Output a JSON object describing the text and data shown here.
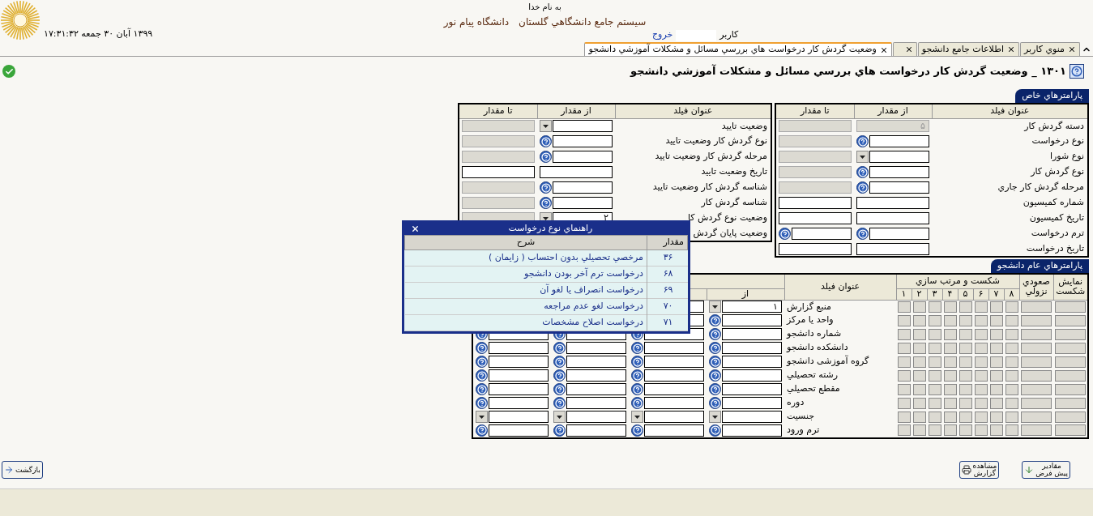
{
  "header": {
    "greeting": "به نام خدا",
    "system_name": "سیستم جامع دانشگاهي گلستان",
    "university": "دانشگاه پیام نور",
    "datetime": "۱۳۹۹ آبان ۳۰ جمعه ۱۷:۳۱:۳۲",
    "user_label": "کاربر",
    "logout": "خروج"
  },
  "tabs": [
    {
      "label": "منوي کاربر",
      "selected": false
    },
    {
      "label": "اطلاعات جامع دانشجو",
      "selected": false
    },
    {
      "selected": false
    },
    {
      "label": "وضعیت گردش کار درخواست هاي بررسي مسائل و مشكلات آموزشي دانشجو",
      "selected": true
    }
  ],
  "page_title": "۱۳۰۱ _ وضعیت  گردش کار درخواست هاي بررسي مسائل و مشكلات آموزشي دانشجو",
  "special_params": {
    "label": "پارامترهاي خاص",
    "tables": [
      {
        "columns": [
          "عنوان فیلد",
          "از مقدار",
          "تا مقدار"
        ],
        "rows": [
          {
            "title": "دسته گردش کار",
            "from": {
              "kind": "text",
              "disabled": true,
              "value": "۵"
            },
            "to": {
              "kind": "text",
              "disabled": true
            }
          },
          {
            "title": "نوع درخواست",
            "from": {
              "kind": "lookup",
              "disabled": false
            },
            "to": {
              "kind": "text",
              "disabled": true
            }
          },
          {
            "title": "نوع شورا",
            "from": {
              "kind": "dropdown",
              "disabled": false
            },
            "to": {
              "kind": "text",
              "disabled": true
            }
          },
          {
            "title": "نوع گردش کار",
            "from": {
              "kind": "lookup",
              "disabled": false
            },
            "to": {
              "kind": "text",
              "disabled": true
            }
          },
          {
            "title": "مرحله گردش کار جاري",
            "from": {
              "kind": "lookup",
              "disabled": false
            },
            "to": {
              "kind": "text",
              "disabled": true
            }
          },
          {
            "title": "شماره کمیسیون",
            "from": {
              "kind": "text",
              "disabled": false
            },
            "to": {
              "kind": "text",
              "disabled": false
            }
          },
          {
            "title": "تاریخ کمیسیون",
            "from": {
              "kind": "text",
              "disabled": false
            },
            "to": {
              "kind": "text",
              "disabled": false
            }
          },
          {
            "title": "ترم درخواست",
            "from": {
              "kind": "lookup",
              "disabled": false
            },
            "to": {
              "kind": "lookup",
              "disabled": false
            }
          },
          {
            "title": "تاریخ درخواست",
            "from": {
              "kind": "text",
              "disabled": false
            },
            "to": {
              "kind": "text",
              "disabled": false
            }
          }
        ]
      },
      {
        "columns": [
          "عنوان فیلد",
          "از مقدار",
          "تا مقدار"
        ],
        "rows": [
          {
            "title": "وضعیت تایید",
            "from": {
              "kind": "dropdown",
              "disabled": false
            },
            "to": {
              "kind": "text",
              "disabled": true
            }
          },
          {
            "title": "نوع گردش کار وضعیت تایید",
            "from": {
              "kind": "lookup",
              "disabled": false
            },
            "to": {
              "kind": "text",
              "disabled": true
            }
          },
          {
            "title": "مرحله گردش کار وضعیت تایید",
            "from": {
              "kind": "lookup",
              "disabled": false
            },
            "to": {
              "kind": "text",
              "disabled": true
            }
          },
          {
            "title": "تاریخ وضعیت تایید",
            "from": {
              "kind": "text",
              "disabled": false
            },
            "to": {
              "kind": "text",
              "disabled": false
            }
          },
          {
            "title": "شناسه گردش کار وضعیت تایید",
            "from": {
              "kind": "lookup",
              "disabled": false
            },
            "to": {
              "kind": "text",
              "disabled": true
            }
          },
          {
            "title": "شناسه گردش کار",
            "from": {
              "kind": "lookup",
              "disabled": false
            },
            "to": {
              "kind": "text",
              "disabled": true
            }
          },
          {
            "title": "وضعیت نوع گردش کا",
            "from": {
              "kind": "dropdown",
              "disabled": false,
              "value": "۲"
            },
            "to": {
              "kind": "text",
              "disabled": true
            }
          },
          {
            "title": "وضعیت پایان گردش"
          }
        ]
      }
    ]
  },
  "general_params": {
    "label": "پارامترهاي عام دانشجو",
    "show_column": "نمایش شکست",
    "sort_column": "صعودي نزولي",
    "break_group": "شکست و مرتب سازي",
    "break_columns": [
      "۸",
      "۷",
      "۶",
      "۵",
      "۴",
      "۳",
      "۲",
      "۱"
    ],
    "field_column": "عنوان فیلد",
    "from_column": "از",
    "rows": [
      {
        "title": "منبع گزارش",
        "kind": "dropdown",
        "value": "۱"
      },
      {
        "title": "واحد یا مرکز",
        "kind": "lookup"
      },
      {
        "title": "شماره دانشجو",
        "kind": "lookup"
      },
      {
        "title": "دانشکده دانشجو",
        "kind": "lookup"
      },
      {
        "title": "گروه آموزشی دانشجو",
        "kind": "lookup"
      },
      {
        "title": "رشته تحصیلي",
        "kind": "lookup"
      },
      {
        "title": "مقطع تحصیلي",
        "kind": "lookup"
      },
      {
        "title": "دوره",
        "kind": "lookup"
      },
      {
        "title": "جنسیت",
        "kind": "dropdown"
      },
      {
        "title": "ترم ورود",
        "kind": "lookup"
      }
    ]
  },
  "popup": {
    "title": "راهنماي نوع درخواست",
    "columns": [
      "مقدار",
      "شرح"
    ],
    "rows": [
      {
        "code": "۳۶",
        "description": "مرخصي تحصیلي بدون احتساب ( زایمان )"
      },
      {
        "code": "۶۸",
        "description": "درخواست ترم آخر بودن دانشجو"
      },
      {
        "code": "۶۹",
        "description": "درخواست انصراف یا لغو آن"
      },
      {
        "code": "۷۰",
        "description": "درخواست لغو عدم مراجعه"
      },
      {
        "code": "۷۱",
        "description": "درخواست اصلاح مشخصات"
      }
    ]
  },
  "buttons": [
    {
      "kind": "defaults",
      "lines": [
        "مقادیر",
        "پیش فرض"
      ]
    },
    {
      "kind": "report",
      "lines": [
        "مشاهده",
        "گزارش"
      ]
    },
    {
      "kind": "back",
      "lines": [
        "بازگشت"
      ]
    }
  ]
}
